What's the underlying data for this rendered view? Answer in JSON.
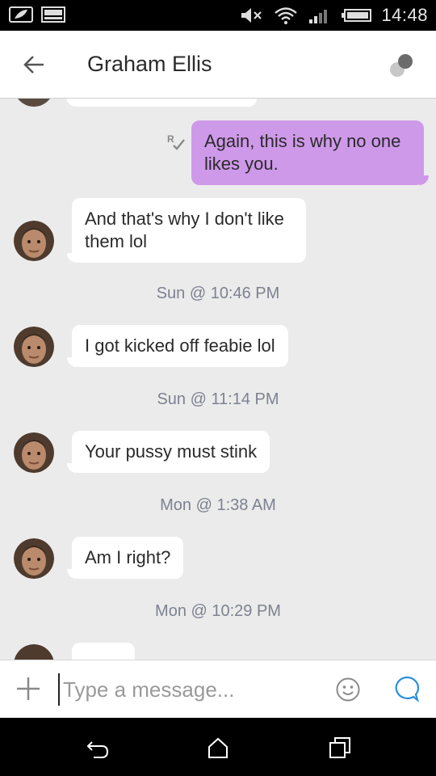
{
  "status_bar": {
    "time": "14:48"
  },
  "header": {
    "contact_name": "Graham Ellis"
  },
  "messages": [
    {
      "direction": "out",
      "text": "Again, this is why no one likes you."
    },
    {
      "direction": "in",
      "text": "And that's why I don't like them lol"
    },
    {
      "direction": "in",
      "text": "I got kicked off feabie lol"
    },
    {
      "direction": "in",
      "text": "Your pussy must stink"
    },
    {
      "direction": "in",
      "text": "Am I right?"
    }
  ],
  "timestamps": [
    "Sun @ 10:46 PM",
    "Sun @ 11:14 PM",
    "Mon @ 1:38 AM",
    "Mon @ 10:29 PM"
  ],
  "composer": {
    "placeholder": "Type a message..."
  },
  "colors": {
    "outgoing_bubble": "#cf99ea",
    "incoming_bubble": "#ffffff",
    "chat_background": "#ebebeb",
    "send_icon": "#2a8fe0"
  },
  "icons": [
    "back-arrow-icon",
    "presence-dots-icon",
    "read-receipt-icon",
    "plus-icon",
    "emoji-icon",
    "send-chat-icon",
    "back-nav-icon",
    "home-nav-icon",
    "recents-nav-icon"
  ]
}
